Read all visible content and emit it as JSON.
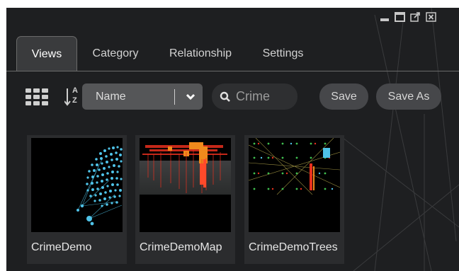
{
  "window": {
    "controls": [
      {
        "name": "minimize",
        "icon": "minimize-icon"
      },
      {
        "name": "maximize",
        "icon": "maximize-icon"
      },
      {
        "name": "popout",
        "icon": "popout-icon"
      },
      {
        "name": "close",
        "icon": "close-icon"
      }
    ]
  },
  "tabs": [
    {
      "label": "Views",
      "active": true
    },
    {
      "label": "Category",
      "active": false
    },
    {
      "label": "Relationship",
      "active": false
    },
    {
      "label": "Settings",
      "active": false
    }
  ],
  "toolbar": {
    "grid_icon": "grid-view-icon",
    "sort_icon": "sort-az-icon",
    "sort_glyph_top": "A",
    "sort_glyph_bottom": "Z",
    "sort_select": {
      "value": "Name",
      "arrow_icon": "chevron-down-icon"
    },
    "search": {
      "icon": "search-icon",
      "value": "",
      "placeholder": "Crime"
    },
    "save_label": "Save",
    "save_as_label": "Save As"
  },
  "views": [
    {
      "name": "CrimeDemo",
      "thumbnail": "crime-demo-thumbnail"
    },
    {
      "name": "CrimeDemoMap",
      "thumbnail": "crime-demo-map-thumbnail"
    },
    {
      "name": "CrimeDemoTrees",
      "thumbnail": "crime-demo-trees-thumbnail"
    }
  ],
  "colors": {
    "panel_bg": "#1e1f21",
    "tab_active_bg": "#3a3b3d",
    "select_bg": "#555658",
    "button_bg": "#46474a",
    "card_bg": "#2b2c2e",
    "node_blue": "#4fc3e8",
    "map_red": "#e8301e",
    "map_orange": "#f08a1c"
  }
}
